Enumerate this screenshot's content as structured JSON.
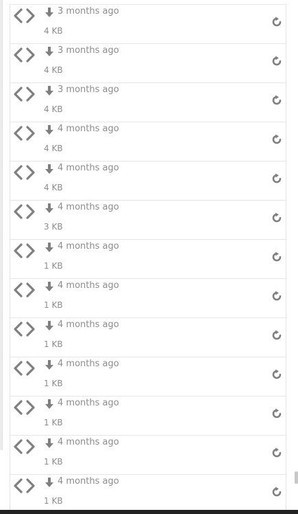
{
  "revisions": [
    {
      "time": "3 months ago",
      "size": "4 KB"
    },
    {
      "time": "3 months ago",
      "size": "4 KB"
    },
    {
      "time": "3 months ago",
      "size": "4 KB"
    },
    {
      "time": "4 months ago",
      "size": "4 KB"
    },
    {
      "time": "4 months ago",
      "size": "4 KB"
    },
    {
      "time": "4 months ago",
      "size": "3 KB"
    },
    {
      "time": "4 months ago",
      "size": "1 KB"
    },
    {
      "time": "4 months ago",
      "size": "1 KB"
    },
    {
      "time": "4 months ago",
      "size": "1 KB"
    },
    {
      "time": "4 months ago",
      "size": "1 KB"
    },
    {
      "time": "4 months ago",
      "size": "1 KB"
    },
    {
      "time": "4 months ago",
      "size": "1 KB"
    },
    {
      "time": "4 months ago",
      "size": "1 KB"
    }
  ],
  "icons": {
    "code": "code-icon",
    "download": "arrow-down-icon",
    "revert": "revert-icon"
  },
  "colors": {
    "icon": "#7f7f7f",
    "text": "#8c8c8c",
    "divider": "#e6e6e6"
  }
}
